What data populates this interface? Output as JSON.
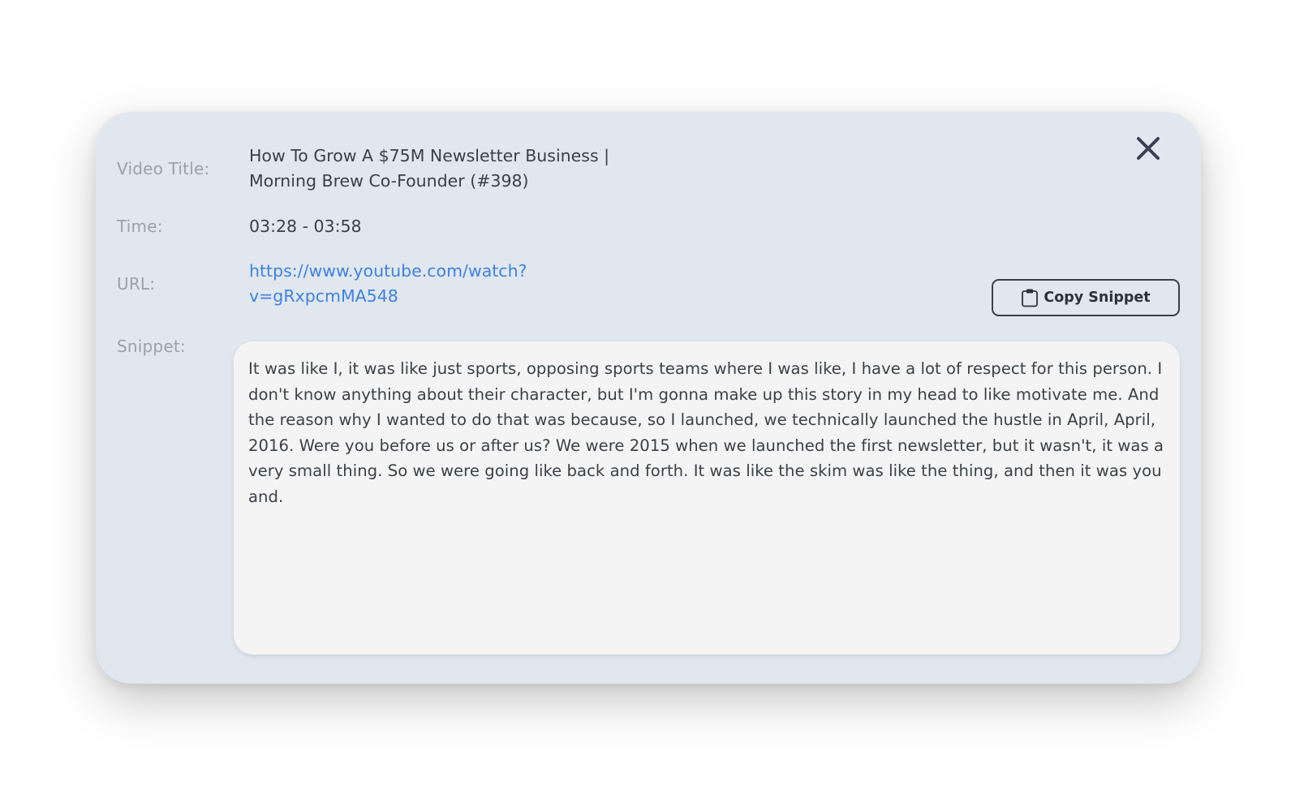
{
  "modal": {
    "close_icon": "close-icon",
    "fields": {
      "video_title": {
        "label": "Video Title:",
        "line1": "How To Grow A $75M Newsletter Business |",
        "line2": "Morning Brew Co-Founder (#398)"
      },
      "time": {
        "label": "Time:",
        "value": "03:28 - 03:58"
      },
      "url": {
        "label": "URL:",
        "line1": "https://www.youtube.com/watch?",
        "line2": "v=gRxpcmMA548"
      },
      "snippet": {
        "label": "Snippet:",
        "text": "It was like I, it was like just sports, opposing sports teams where I was like, I have a lot of respect for this person. I don't know anything about their character, but I'm gonna make up this story in my head to like motivate me. And the reason why I wanted to do that was because, so I launched, we technically launched the hustle in April, April, 2016. Were you before us or after us? We were 2015 when we launched the first newsletter, but it wasn't, it was a very small thing. So we were going like back and forth. It was like the skim was like the thing, and then it was you and."
      }
    },
    "copy_button": {
      "label": "Copy Snippet",
      "icon": "clipboard-icon"
    }
  },
  "colors": {
    "modal_bg": "#e1e7ef",
    "label": "#9aa1ac",
    "text": "#3b4048",
    "link": "#3d82e0",
    "snippet_bg": "#f4f4f4"
  }
}
